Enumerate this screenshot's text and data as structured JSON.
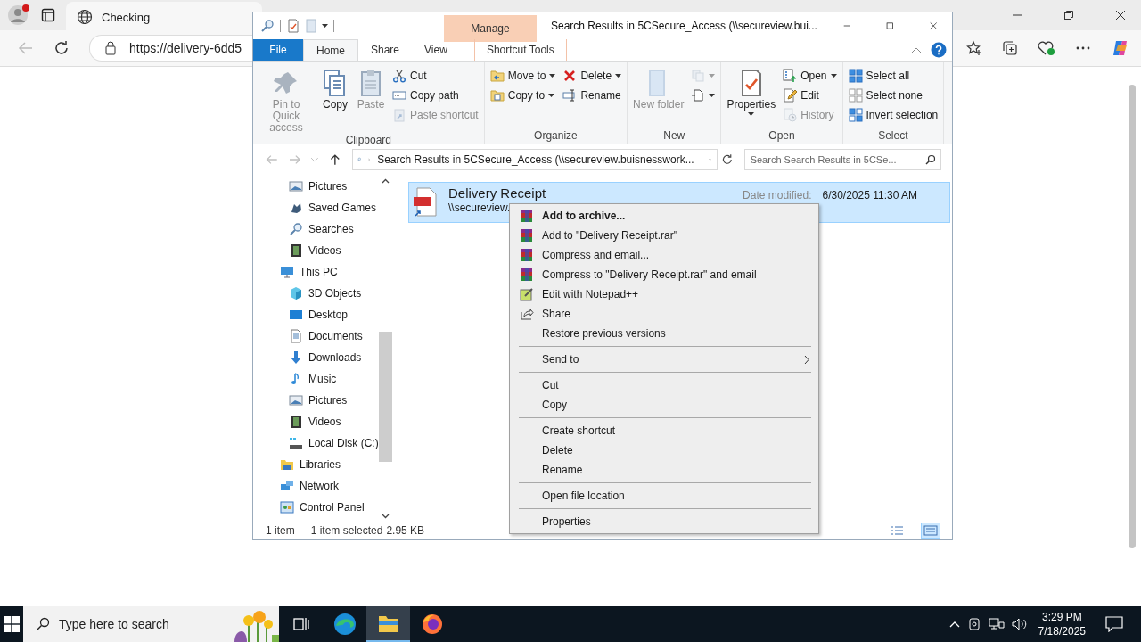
{
  "browser": {
    "tab_title": "Checking",
    "address": "https://delivery-6dd5"
  },
  "explorer": {
    "title": "Search Results in 5CSecure_Access (\\\\secureview.bui...",
    "context_group": "Manage",
    "tabs": [
      {
        "label": "File",
        "kind": "file",
        "selected": false
      },
      {
        "label": "Home",
        "kind": "normal",
        "selected": true
      },
      {
        "label": "Share",
        "kind": "normal",
        "selected": false
      },
      {
        "label": "View",
        "kind": "normal",
        "selected": false
      },
      {
        "label": "Shortcut Tools",
        "kind": "contextual",
        "selected": false
      }
    ],
    "ribbon": [
      {
        "label": "Clipboard",
        "columns": [
          {
            "kind": "large",
            "label": "Pin to Quick access",
            "disabled": true,
            "dropdown": false
          },
          {
            "kind": "large",
            "label": "Copy",
            "disabled": false,
            "dropdown": false
          },
          {
            "kind": "large",
            "label": "Paste",
            "disabled": true,
            "dropdown": false
          },
          {
            "kind": "stack",
            "items": [
              {
                "label": "Cut",
                "disabled": false,
                "dropdown": false
              },
              {
                "label": "Copy path",
                "disabled": false,
                "dropdown": false
              },
              {
                "label": "Paste shortcut",
                "disabled": true,
                "dropdown": false
              }
            ]
          }
        ]
      },
      {
        "label": "Organize",
        "columns": [
          {
            "kind": "stack",
            "items": [
              {
                "label": "Move to",
                "disabled": false,
                "dropdown": true
              },
              {
                "label": "Copy to",
                "disabled": false,
                "dropdown": true
              }
            ]
          },
          {
            "kind": "stack",
            "items": [
              {
                "label": "Delete",
                "disabled": false,
                "dropdown": true
              },
              {
                "label": "Rename",
                "disabled": false,
                "dropdown": false
              }
            ]
          }
        ]
      },
      {
        "label": "New",
        "columns": [
          {
            "kind": "large",
            "label": "New folder",
            "disabled": true,
            "dropdown": false
          },
          {
            "kind": "stack",
            "items": [
              {
                "disabled": true,
                "dropdown": true
              },
              {
                "disabled": false,
                "dropdown": true
              }
            ]
          }
        ]
      },
      {
        "label": "Open",
        "columns": [
          {
            "kind": "large",
            "label": "Properties",
            "disabled": false,
            "dropdown": true
          },
          {
            "kind": "stack",
            "items": [
              {
                "label": "Open",
                "disabled": false,
                "dropdown": true
              },
              {
                "label": "Edit",
                "disabled": false,
                "dropdown": false
              },
              {
                "label": "History",
                "disabled": true,
                "dropdown": false
              }
            ]
          }
        ]
      },
      {
        "label": "Select",
        "columns": [
          {
            "kind": "stack",
            "items": [
              {
                "label": "Select all",
                "disabled": false,
                "dropdown": false
              },
              {
                "label": "Select none",
                "disabled": false,
                "dropdown": false
              },
              {
                "label": "Invert selection",
                "disabled": false,
                "dropdown": false
              }
            ]
          }
        ]
      }
    ],
    "address": "Search Results in 5CSecure_Access (\\\\secureview.buisnesswork...",
    "search_placeholder": "Search Search Results in 5CSe...",
    "nav_partial_children": [
      {
        "label": "Pictures"
      },
      {
        "label": "Saved Games"
      },
      {
        "label": "Searches"
      },
      {
        "label": "Videos"
      }
    ],
    "nav_tree": [
      {
        "label": "This PC",
        "children": [
          {
            "label": "3D Objects"
          },
          {
            "label": "Desktop"
          },
          {
            "label": "Documents"
          },
          {
            "label": "Downloads"
          },
          {
            "label": "Music"
          },
          {
            "label": "Pictures"
          },
          {
            "label": "Videos"
          },
          {
            "label": "Local Disk (C:)"
          }
        ]
      },
      {
        "label": "Libraries"
      },
      {
        "label": "Network"
      },
      {
        "label": "Control Panel"
      }
    ],
    "file": {
      "name": "Delivery Receipt",
      "path": "\\\\secureview.",
      "date_label": "Date modified:",
      "date": "6/30/2025 11:30 AM",
      "selected": true
    },
    "status": {
      "count": "1 item",
      "selection": "1 item selected",
      "size": "2.95 KB"
    },
    "view_modes": [
      {
        "kind": "details",
        "selected": false
      },
      {
        "kind": "tiles",
        "selected": true
      }
    ]
  },
  "context_menu": [
    {
      "kind": "item",
      "label": "Add to archive...",
      "default": true
    },
    {
      "kind": "item",
      "label": "Add to \"Delivery Receipt.rar\"",
      "default": false
    },
    {
      "kind": "item",
      "label": "Compress and email...",
      "default": false
    },
    {
      "kind": "item",
      "label": "Compress to \"Delivery Receipt.rar\" and email",
      "default": false
    },
    {
      "kind": "item",
      "label": "Edit with Notepad++",
      "default": false
    },
    {
      "kind": "item",
      "label": "Share",
      "default": false
    },
    {
      "kind": "item",
      "label": "Restore previous versions",
      "default": false
    },
    {
      "kind": "separator"
    },
    {
      "kind": "submenu",
      "label": "Send to",
      "default": false
    },
    {
      "kind": "separator"
    },
    {
      "kind": "item",
      "label": "Cut",
      "default": false
    },
    {
      "kind": "item",
      "label": "Copy",
      "default": false
    },
    {
      "kind": "separator"
    },
    {
      "kind": "item",
      "label": "Create shortcut",
      "default": false
    },
    {
      "kind": "item",
      "label": "Delete",
      "default": false
    },
    {
      "kind": "item",
      "label": "Rename",
      "default": false
    },
    {
      "kind": "separator"
    },
    {
      "kind": "item",
      "label": "Open file location",
      "default": false
    },
    {
      "kind": "separator"
    },
    {
      "kind": "item",
      "label": "Properties",
      "default": false
    }
  ],
  "taskbar": {
    "search_placeholder": "Type here to search",
    "time": "3:29 PM",
    "date": "7/18/2025",
    "apps": [
      {
        "kind": "task-view",
        "selected": false
      },
      {
        "kind": "edge",
        "selected": false
      },
      {
        "kind": "explorer",
        "selected": true
      },
      {
        "kind": "firefox",
        "selected": false
      }
    ]
  }
}
